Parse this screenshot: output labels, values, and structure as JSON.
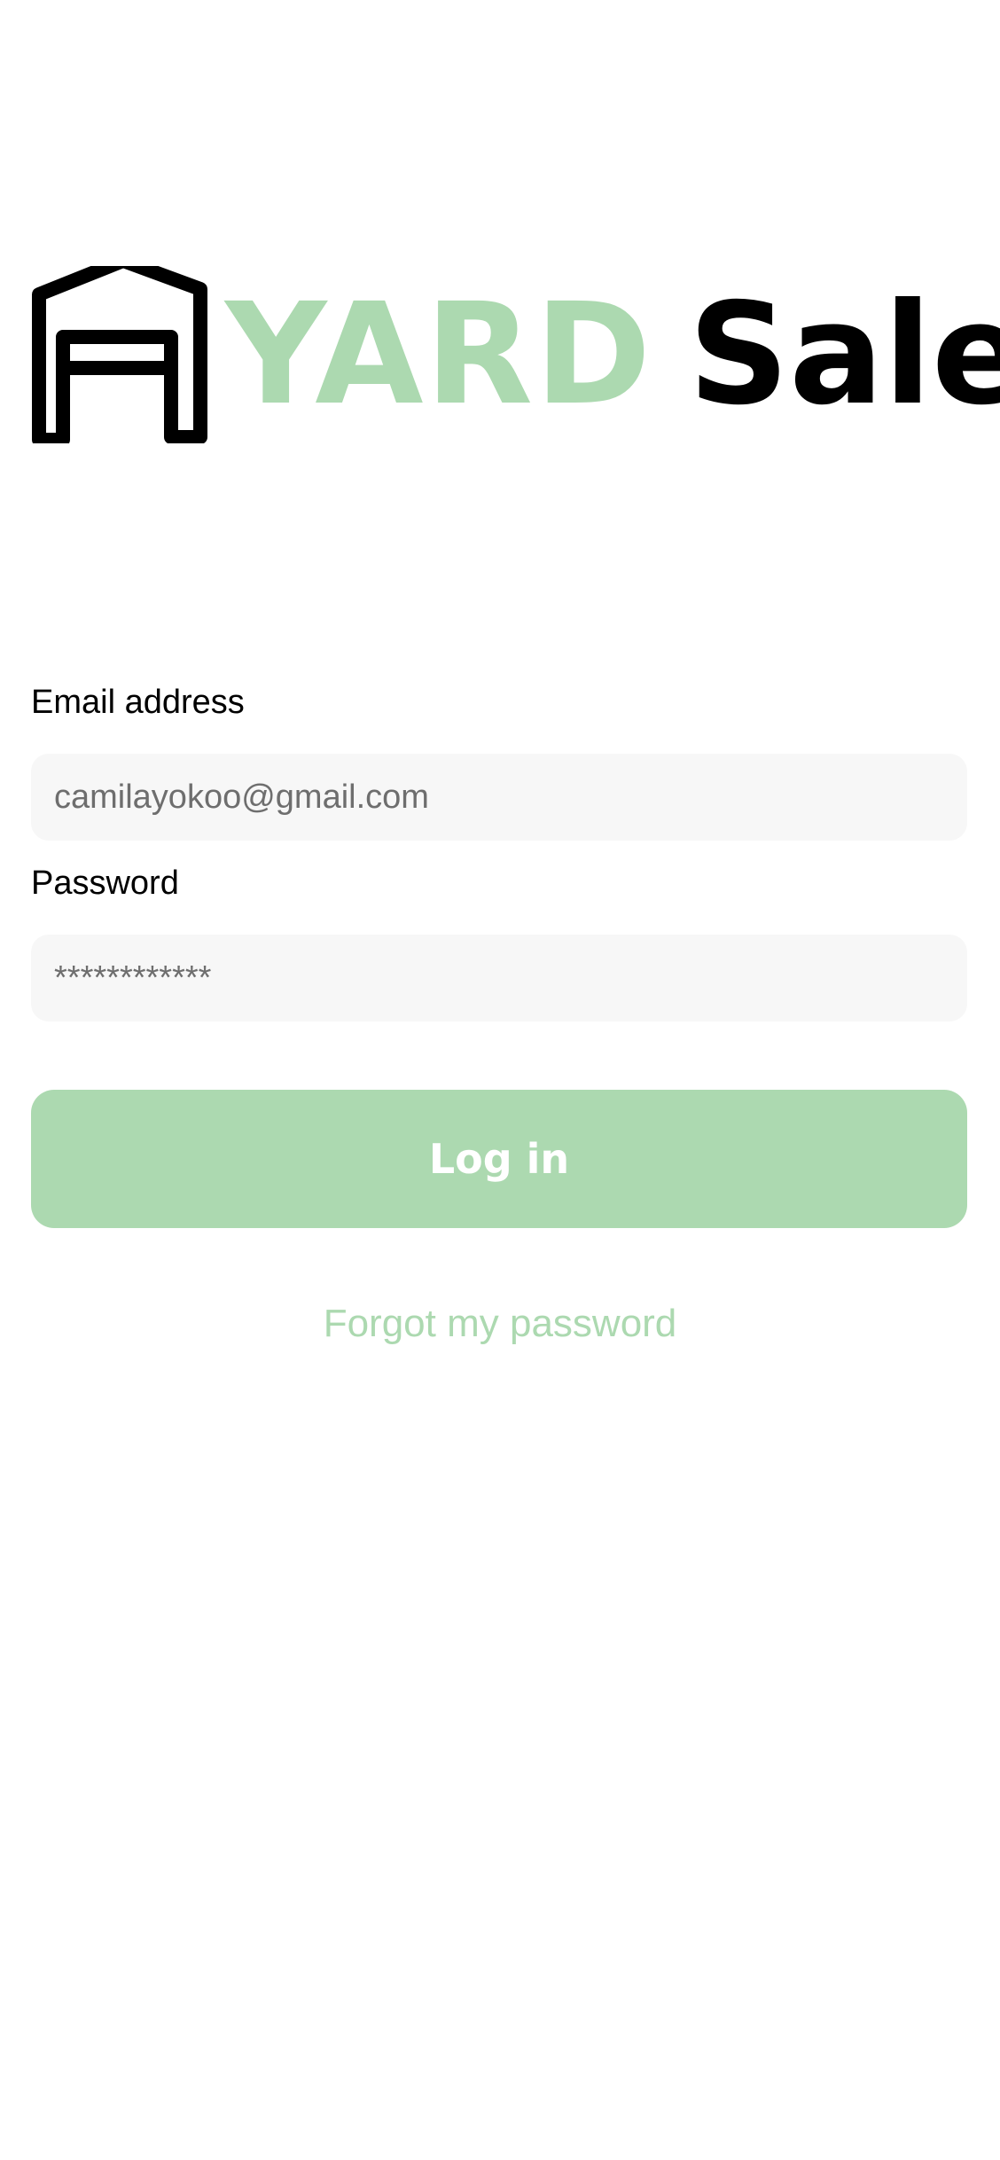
{
  "logo": {
    "brand_yard": "YARD",
    "brand_sale": "Sale",
    "icon": "garage-house-icon"
  },
  "form": {
    "email_label": "Email address",
    "email_placeholder": "camilayokoo@gmail.com",
    "password_label": "Password",
    "password_placeholder": "************"
  },
  "actions": {
    "login_label": "Log in",
    "forgot_label": "Forgot my password"
  },
  "colors": {
    "accent": "#acd9b0",
    "input_bg": "#f7f7f7",
    "text": "#000000",
    "placeholder": "#6e6e6e"
  }
}
